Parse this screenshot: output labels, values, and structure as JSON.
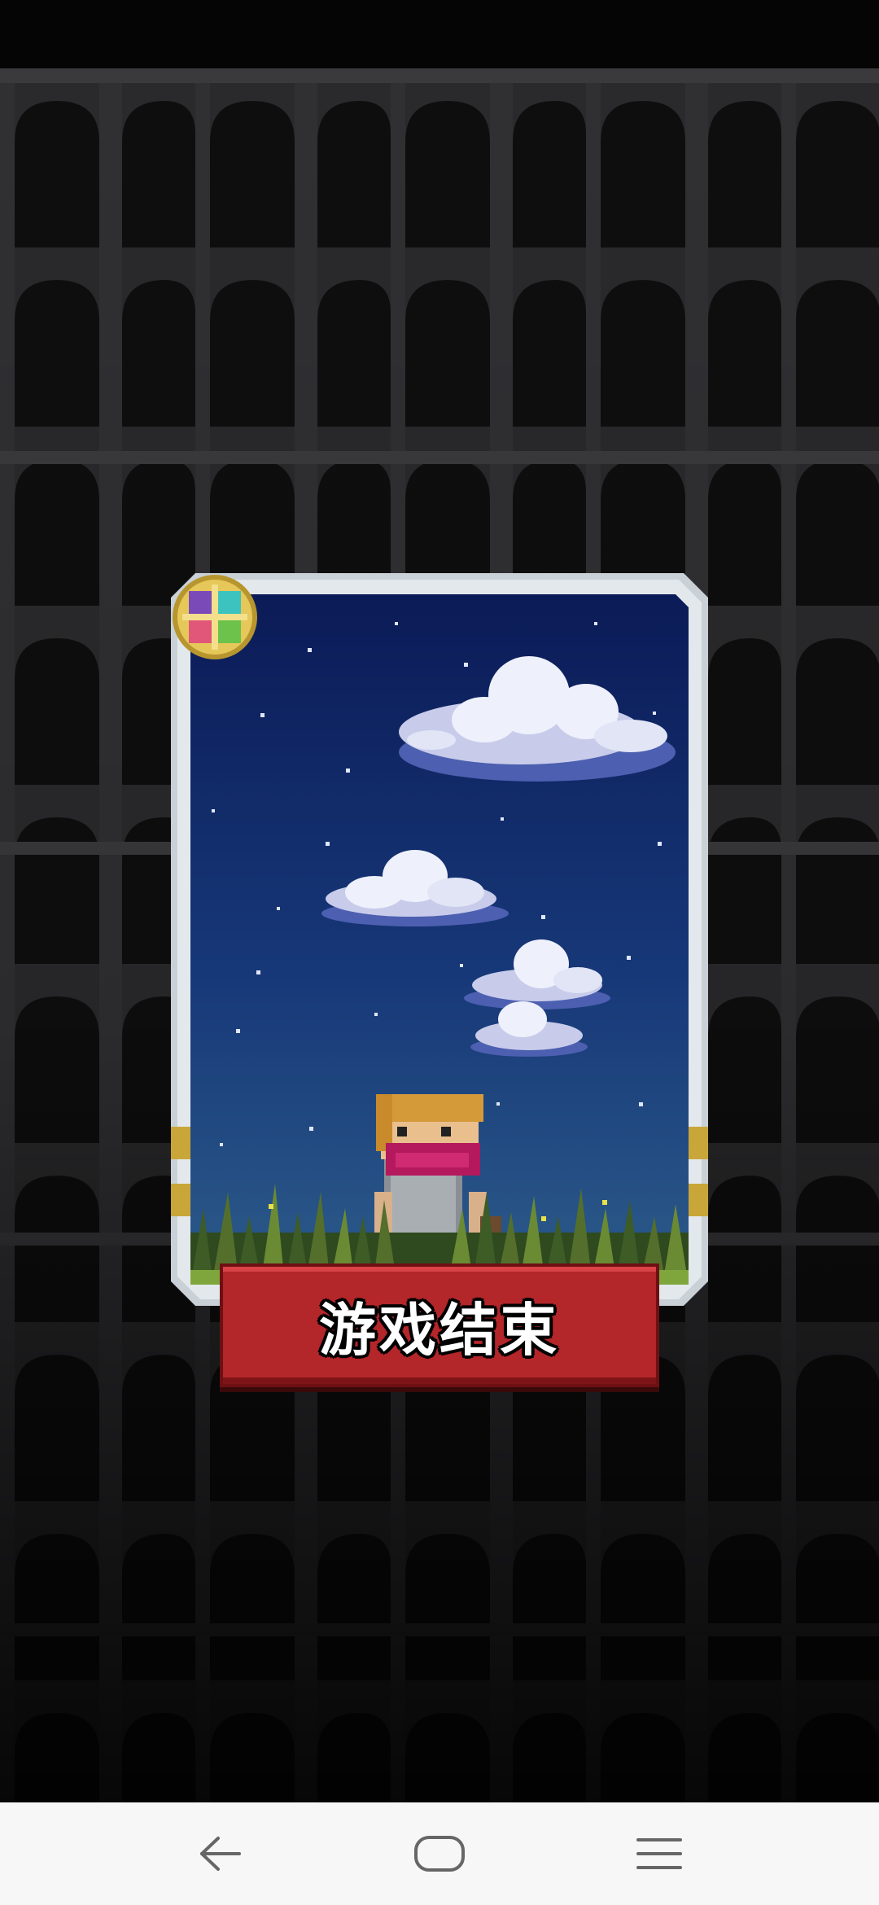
{
  "screen": {
    "title": "Game Over"
  },
  "card": {
    "emblem_icon": "four-color-rune-emblem-icon",
    "scene": "night-sky-hero-in-grass"
  },
  "gameover_button": {
    "label": "游戏结束"
  },
  "navigation": {
    "back_icon": "back-arrow-icon",
    "home_icon": "home-rounded-rect-icon",
    "menu_icon": "menu-lines-icon"
  },
  "colors": {
    "button_red": "#b3262a",
    "sky_top": "#0b1b57",
    "sky_bottom": "#2c5b8a",
    "frame_silver": "#c9d0d6",
    "nav_bar": "#f7f7f7"
  }
}
